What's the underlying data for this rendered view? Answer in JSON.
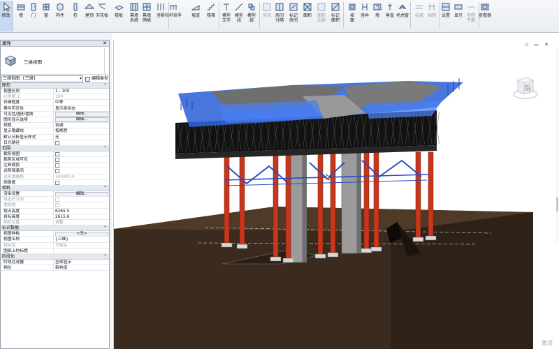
{
  "ribbon": {
    "modify": "修改",
    "buttons": [
      {
        "label": "墙",
        "icon": "wall-icon"
      },
      {
        "label": "门",
        "icon": "door-icon"
      },
      {
        "label": "窗",
        "icon": "window-icon"
      },
      {
        "label": "构件",
        "icon": "component-icon"
      },
      {
        "label": "柱",
        "icon": "column-icon"
      },
      {
        "label": "屋顶",
        "icon": "roof-icon"
      },
      {
        "label": "天花板",
        "icon": "ceiling-icon"
      },
      {
        "label": "楼板",
        "icon": "floor-icon"
      },
      {
        "label": "幕墙\n系统",
        "icon": "curtain-system-icon"
      },
      {
        "label": "幕墙\n网格",
        "icon": "curtain-grid-icon"
      },
      {
        "label": "竖梃",
        "icon": "mullion-icon"
      },
      {
        "label": "栏杆扶手",
        "icon": "railing-icon"
      },
      {
        "label": "坡道",
        "icon": "ramp-icon"
      },
      {
        "label": "楼梯",
        "icon": "stair-icon"
      },
      {
        "label": "模型\n文字",
        "icon": "model-text-icon"
      },
      {
        "label": "模型\n线",
        "icon": "model-line-icon"
      },
      {
        "label": "模型\n组",
        "icon": "model-group-icon"
      },
      {
        "label": "房间",
        "icon": "room-icon",
        "disabled": true
      },
      {
        "label": "房间\n分隔",
        "icon": "room-separator-icon"
      },
      {
        "label": "标记\n房间",
        "icon": "tag-room-icon"
      },
      {
        "label": "面积",
        "icon": "area-icon"
      },
      {
        "label": "面积\n边界",
        "icon": "area-boundary-icon",
        "disabled": true
      },
      {
        "label": "标记\n面积",
        "icon": "tag-area-icon"
      },
      {
        "label": "按\n面",
        "icon": "by-face-icon"
      },
      {
        "label": "竖井",
        "icon": "shaft-icon"
      },
      {
        "label": "墙",
        "icon": "opening-wall-icon"
      },
      {
        "label": "垂直",
        "icon": "vertical-icon"
      },
      {
        "label": "老虎窗",
        "icon": "dormer-icon"
      },
      {
        "label": "标高",
        "icon": "level-icon",
        "disabled": true
      },
      {
        "label": "轴网",
        "icon": "grid-icon",
        "disabled": true
      },
      {
        "label": "设置",
        "icon": "set-icon"
      },
      {
        "label": "显示",
        "icon": "show-icon"
      },
      {
        "label": "参照\n平面",
        "icon": "ref-plane-icon",
        "disabled": true
      },
      {
        "label": "查看器",
        "icon": "viewer-icon"
      }
    ]
  },
  "properties": {
    "title": "属性",
    "type_name": "三维视图",
    "instance_selector": "三维视图: {三维}",
    "edit_type": "编辑类型",
    "sections": [
      {
        "name": "图形",
        "rows": [
          {
            "key": "视图比例",
            "value": "1 : 100"
          },
          {
            "key": "比例值 1:",
            "value": "100",
            "dim": true
          },
          {
            "key": "详细程度",
            "value": "中等"
          },
          {
            "key": "零件可见性",
            "value": "显示原状态"
          },
          {
            "key": "可见性/图形替换",
            "button": "编辑..."
          },
          {
            "key": "图形显示选项",
            "button": "编辑..."
          },
          {
            "key": "规程",
            "value": "协调"
          },
          {
            "key": "显示隐藏线",
            "value": "按规程"
          },
          {
            "key": "默认分析显示样式",
            "value": "无"
          },
          {
            "key": "日光路径",
            "check": true
          }
        ]
      },
      {
        "name": "范围",
        "rows": [
          {
            "key": "裁剪视图",
            "check": true
          },
          {
            "key": "裁剪区域可见",
            "check": true
          },
          {
            "key": "注释裁剪",
            "check": true
          },
          {
            "key": "远剪裁激活",
            "check": true
          },
          {
            "key": "远剪裁偏移",
            "value": "304800.0",
            "dim": true
          },
          {
            "key": "剖面框",
            "check": true
          }
        ]
      },
      {
        "name": "相机",
        "rows": [
          {
            "key": "渲染设置",
            "button": "编辑..."
          },
          {
            "key": "锁定的方向",
            "check": true,
            "dim": true
          },
          {
            "key": "透视图",
            "check": true,
            "dim": true
          },
          {
            "key": "视点高度",
            "value": "6265.5"
          },
          {
            "key": "目标高度",
            "value": "2615.6"
          },
          {
            "key": "相机位置",
            "value": "调整",
            "dim": true
          }
        ]
      },
      {
        "name": "标识数据",
        "rows": [
          {
            "key": "视图样板",
            "button": "<无>"
          },
          {
            "key": "视图名称",
            "value": "{三维}"
          },
          {
            "key": "相关性",
            "value": "不相关",
            "dim": true
          },
          {
            "key": "图纸上的标题",
            "value": ""
          }
        ]
      },
      {
        "name": "阶段化",
        "rows": [
          {
            "key": "阶段过滤器",
            "value": "全部显示"
          },
          {
            "key": "相位",
            "value": "新构造"
          }
        ]
      }
    ]
  },
  "viewport": {
    "controls": "▫ ▭ ✕",
    "viewcube_face": "后",
    "watermark": "激活"
  },
  "colors": {
    "formwork_blue": "#2f63d8",
    "steel_pile_red": "#c8361c",
    "truss_black": "#151515",
    "soil_brown": "#3a2b1e",
    "concrete_gray": "#8a8a8a"
  }
}
